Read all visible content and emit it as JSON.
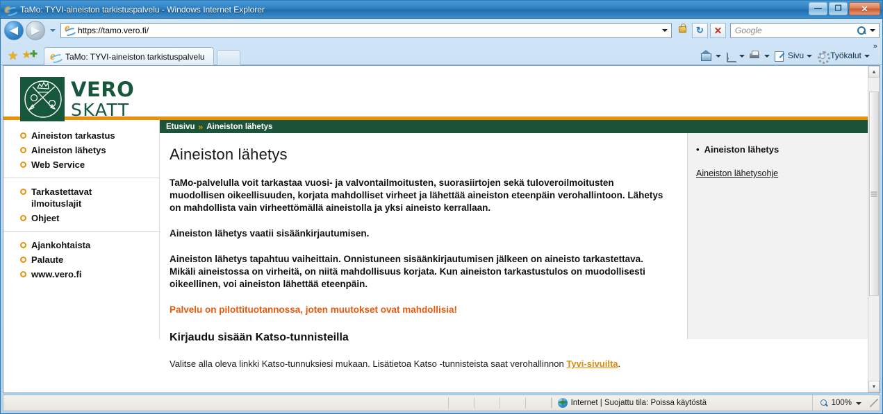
{
  "window": {
    "title": "TaMo: TYVI-aineiston tarkistuspalvelu - Windows Internet Explorer",
    "minimize_label": "—",
    "restore_label": "❐",
    "close_label": "✕"
  },
  "toolbar": {
    "back_label": "◀",
    "forward_label": "▶",
    "url": "https://tamo.vero.fi/",
    "refresh_label": "↻",
    "stop_label": "✕",
    "search_placeholder": "Google",
    "page_menu_label": "Sivu",
    "tools_menu_label": "Työkalut",
    "overflow_label": "»"
  },
  "tabs": {
    "items": [
      {
        "label": "TaMo: TYVI-aineiston tarkistuspalvelu",
        "active": true
      }
    ]
  },
  "site": {
    "logo": {
      "word1": "VERO",
      "word2": "SKATT"
    },
    "breadcrumb": {
      "home": "Etusivu",
      "separator": "»",
      "current": "Aineiston lähetys"
    },
    "accent_orange": "#e8920c",
    "accent_green": "#1d5338",
    "alert_color": "#e8590c"
  },
  "sidebar": {
    "groups": [
      {
        "items": [
          {
            "label": "Aineiston tarkastus"
          },
          {
            "label": "Aineiston lähetys"
          },
          {
            "label": "Web Service"
          }
        ]
      },
      {
        "items": [
          {
            "label": "Tarkastettavat ilmoituslajit"
          },
          {
            "label": "Ohjeet"
          }
        ]
      },
      {
        "items": [
          {
            "label": "Ajankohtaista"
          },
          {
            "label": "Palaute"
          },
          {
            "label": "www.vero.fi"
          }
        ]
      }
    ]
  },
  "main": {
    "heading": "Aineiston lähetys",
    "paragraph1": "TaMo-palvelulla voit tarkastaa vuosi- ja valvontailmoitusten, suorasiirtojen sekä tuloveroilmoitusten muodollisen oikeellisuuden, korjata mahdolliset virheet ja lähettää aineiston eteenpäin verohallintoon. Lähetys on mahdollista vain virheettömällä aineistolla ja yksi aineisto kerrallaan.",
    "paragraph2": "Aineiston lähetys vaatii sisäänkirjautumisen.",
    "paragraph3": "Aineiston lähetys tapahtuu vaiheittain. Onnistuneen sisäänkirjautumisen jälkeen on aineisto tarkastettava. Mikäli aineistossa on virheitä, on niitä mahdollisuus korjata. Kun aineiston tarkastustulos on muodollisesti oikeellinen, voi aineiston lähettää eteenpäin.",
    "alert": "Palvelu on pilottituotannossa, joten muutokset ovat mahdollisia!",
    "subheading": "Kirjaudu sisään Katso-tunnisteilla",
    "login_text_before": "Valitse alla oleva linkki Katso-tunnuksiesi mukaan. Lisätietoa Katso -tunnisteista saat verohallinnon ",
    "login_link": "Tyvi-sivuilta",
    "login_text_after": "."
  },
  "rail": {
    "bullet": "•",
    "heading": "Aineiston lähetys",
    "link": "Aineiston lähetysohje"
  },
  "scrollbar": {
    "up_label": "▲",
    "down_label": "▼"
  },
  "statusbar": {
    "zone_text": "Internet | Suojattu tila: Poissa käytöstä",
    "zoom_level": "100%"
  }
}
